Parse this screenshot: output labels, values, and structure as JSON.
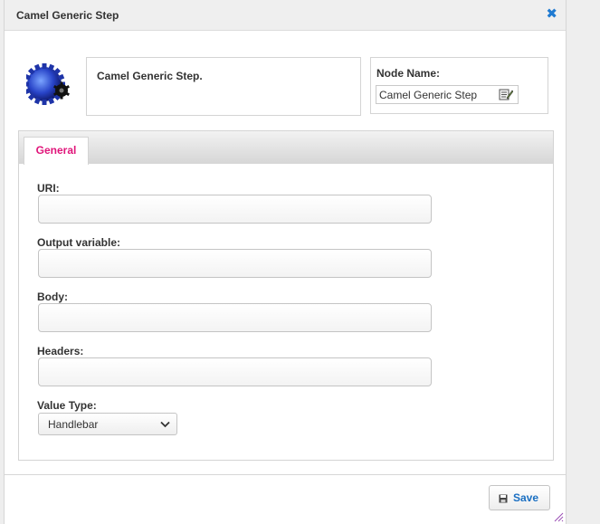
{
  "dialog": {
    "title": "Camel Generic Step",
    "close_icon": "close-icon",
    "description": "Camel Generic Step.",
    "node_name_label": "Node Name:",
    "node_name_value": "Camel Generic Step"
  },
  "tabs": [
    {
      "label": "General",
      "active": true
    }
  ],
  "form": {
    "uri_label": "URI:",
    "uri_value": "",
    "output_label": "Output variable:",
    "output_value": "",
    "body_label": "Body:",
    "body_value": "",
    "headers_label": "Headers:",
    "headers_value": "",
    "value_type_label": "Value Type:",
    "value_type_selected": "Handlebar"
  },
  "footer": {
    "save_label": "Save",
    "save_icon": "save-icon"
  },
  "colors": {
    "accent_blue": "#1a6fc2",
    "tab_active": "#e0157a"
  }
}
